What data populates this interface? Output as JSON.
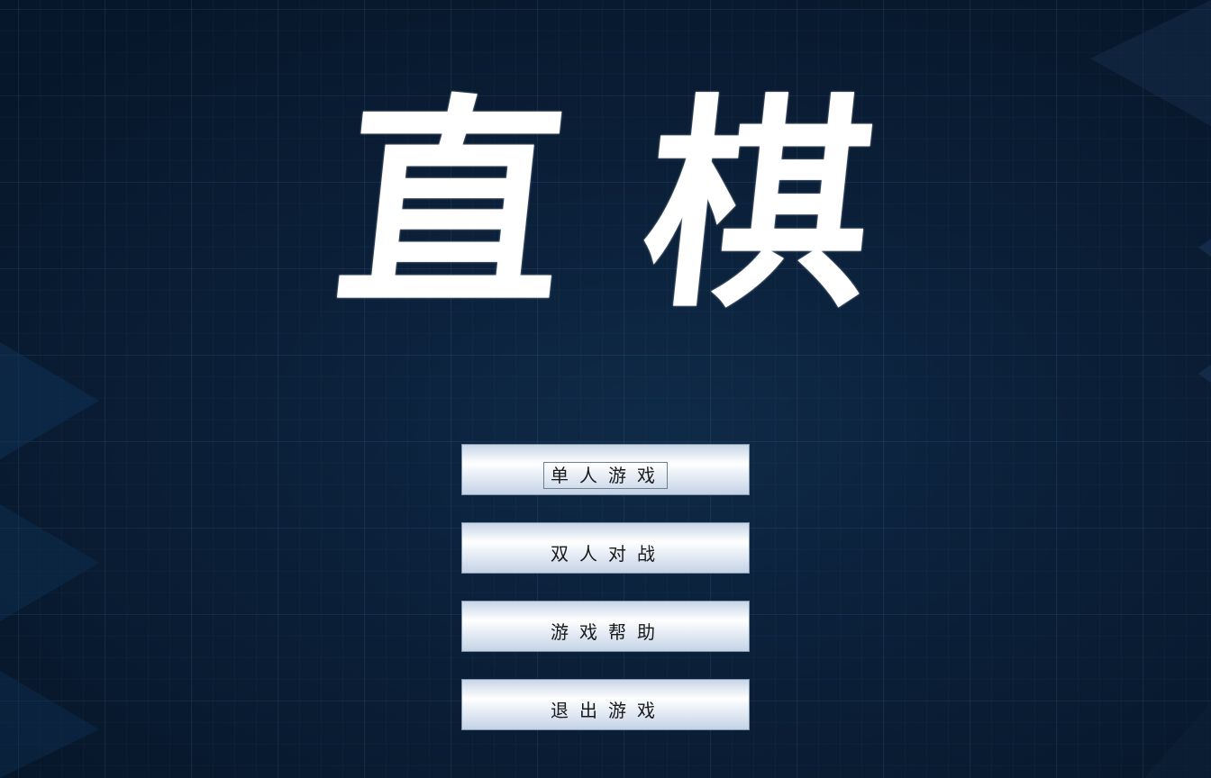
{
  "title": "直棋",
  "menu": {
    "buttons": [
      {
        "label": "单人游戏",
        "focused": true
      },
      {
        "label": "双人对战",
        "focused": false
      },
      {
        "label": "游戏帮助",
        "focused": false
      },
      {
        "label": "退出游戏",
        "focused": false
      }
    ]
  },
  "colors": {
    "background": "#0b2039",
    "title": "#ffffff",
    "button_top": "#c7d5e6",
    "button_mid": "#ffffff",
    "button_bottom": "#c4d3e5",
    "button_text": "#1a1a1a"
  }
}
